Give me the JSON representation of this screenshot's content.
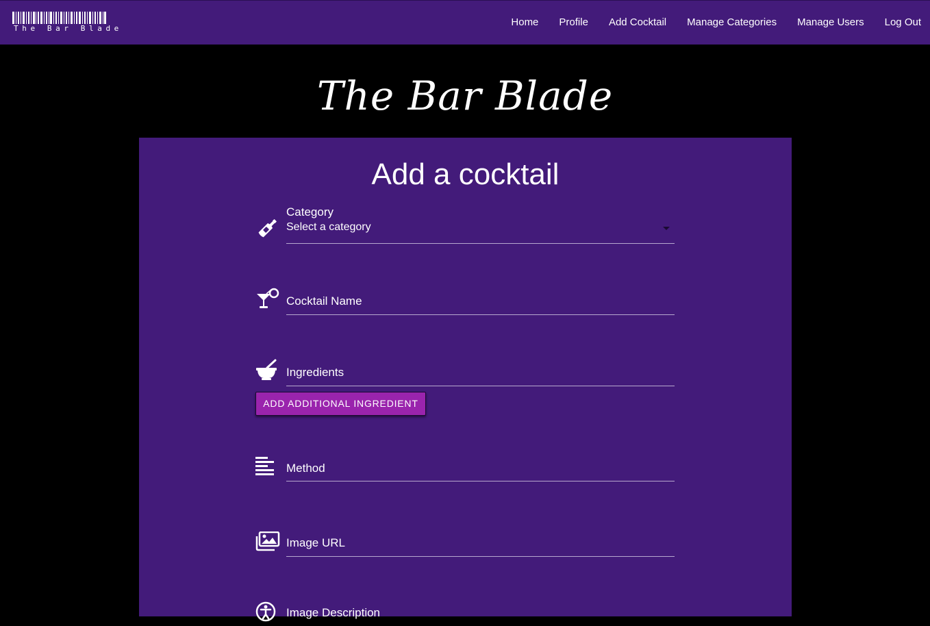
{
  "nav": {
    "brand": "The Bar Blade",
    "links": [
      "Home",
      "Profile",
      "Add Cocktail",
      "Manage Categories",
      "Manage Users",
      "Log Out"
    ]
  },
  "site_title": "The Bar Blade",
  "form": {
    "title": "Add a cocktail",
    "category": {
      "label": "Category",
      "selected": "Select a category",
      "icon": "wine-bottle-icon"
    },
    "cocktail_name": {
      "label": "Cocktail Name",
      "icon": "cocktail-glass-icon"
    },
    "ingredients": {
      "label": "Ingredients",
      "icon": "mortar-pestle-icon"
    },
    "add_ingredient_button": "ADD ADDITIONAL INGREDIENT",
    "method": {
      "label": "Method",
      "icon": "align-left-icon"
    },
    "image_url": {
      "label": "Image URL",
      "icon": "images-icon"
    },
    "image_description": {
      "label": "Image Description",
      "icon": "accessibility-icon"
    }
  },
  "colors": {
    "primary": "#431b7a",
    "button": "#9a24ad",
    "background": "#000000"
  }
}
